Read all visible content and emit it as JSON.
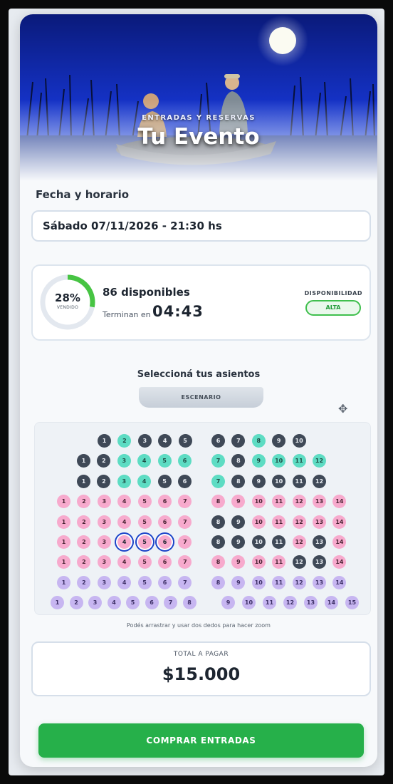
{
  "hero": {
    "eyebrow": "ENTRADAS Y RESERVAS",
    "title": "Tu Evento"
  },
  "schedule": {
    "label": "Fecha y horario",
    "selected": "Sábado 07/11/2026 - 21:30 hs"
  },
  "status": {
    "sold_fraction": 0.28,
    "sold_percent": "28%",
    "sold_caption": "VENDIDO",
    "available": "86 disponibles",
    "ends_label": "Terminan en",
    "timer": "04:43",
    "availability_label": "DISPONIBILIDAD",
    "availability_value": "ALTA",
    "colors": {
      "ring": "#47c443",
      "ring_track": "#e3e8ef",
      "badge": "#3fbf4d"
    }
  },
  "seats": {
    "title": "Seleccioná tus asientos",
    "stage": "ESCENARIO",
    "compass_icon": "move-icon",
    "hint": "Podés arrastrar y usar dos dedos para hacer zoom",
    "rows": [
      {
        "left": [
          [
            "1",
            "dark"
          ],
          [
            "2",
            "teal"
          ],
          [
            "3",
            "dark"
          ],
          [
            "4",
            "dark"
          ],
          [
            "5",
            "dark"
          ]
        ],
        "right": [
          [
            "6",
            "dark"
          ],
          [
            "7",
            "dark"
          ],
          [
            "8",
            "teal"
          ],
          [
            "9",
            "dark"
          ],
          [
            "10",
            "dark"
          ]
        ]
      },
      {
        "left": [
          [
            "1",
            "dark"
          ],
          [
            "2",
            "dark"
          ],
          [
            "3",
            "teal"
          ],
          [
            "4",
            "teal"
          ],
          [
            "5",
            "teal"
          ],
          [
            "6",
            "teal"
          ]
        ],
        "right": [
          [
            "7",
            "teal"
          ],
          [
            "8",
            "dark"
          ],
          [
            "9",
            "teal"
          ],
          [
            "10",
            "teal"
          ],
          [
            "11",
            "teal"
          ],
          [
            "12",
            "teal"
          ]
        ]
      },
      {
        "left": [
          [
            "1",
            "dark"
          ],
          [
            "2",
            "dark"
          ],
          [
            "3",
            "teal"
          ],
          [
            "4",
            "teal"
          ],
          [
            "5",
            "dark"
          ],
          [
            "6",
            "dark"
          ]
        ],
        "right": [
          [
            "7",
            "teal"
          ],
          [
            "8",
            "dark"
          ],
          [
            "9",
            "dark"
          ],
          [
            "10",
            "dark"
          ],
          [
            "11",
            "dark"
          ],
          [
            "12",
            "dark"
          ]
        ]
      },
      {
        "left": [
          [
            "1",
            "pink"
          ],
          [
            "2",
            "pink"
          ],
          [
            "3",
            "pink"
          ],
          [
            "4",
            "pink"
          ],
          [
            "5",
            "pink"
          ],
          [
            "6",
            "pink"
          ],
          [
            "7",
            "pink"
          ]
        ],
        "right": [
          [
            "8",
            "pink"
          ],
          [
            "9",
            "pink"
          ],
          [
            "10",
            "pink"
          ],
          [
            "11",
            "pink"
          ],
          [
            "12",
            "pink"
          ],
          [
            "13",
            "pink"
          ],
          [
            "14",
            "pink"
          ]
        ]
      },
      {
        "left": [
          [
            "1",
            "pink"
          ],
          [
            "2",
            "pink"
          ],
          [
            "3",
            "pink"
          ],
          [
            "4",
            "pink"
          ],
          [
            "5",
            "pink"
          ],
          [
            "6",
            "pink"
          ],
          [
            "7",
            "pink"
          ]
        ],
        "right": [
          [
            "8",
            "dark"
          ],
          [
            "9",
            "dark"
          ],
          [
            "10",
            "pink"
          ],
          [
            "11",
            "pink"
          ],
          [
            "12",
            "pink"
          ],
          [
            "13",
            "pink"
          ],
          [
            "14",
            "pink"
          ]
        ]
      },
      {
        "left": [
          [
            "1",
            "pink"
          ],
          [
            "2",
            "pink"
          ],
          [
            "3",
            "pink"
          ],
          [
            "4",
            "sel"
          ],
          [
            "5",
            "sel"
          ],
          [
            "6",
            "sel"
          ],
          [
            "7",
            "pink"
          ]
        ],
        "right": [
          [
            "8",
            "dark"
          ],
          [
            "9",
            "dark"
          ],
          [
            "10",
            "dark"
          ],
          [
            "11",
            "dark"
          ],
          [
            "12",
            "pink"
          ],
          [
            "13",
            "dark"
          ],
          [
            "14",
            "pink"
          ]
        ]
      },
      {
        "left": [
          [
            "1",
            "pink"
          ],
          [
            "2",
            "pink"
          ],
          [
            "3",
            "pink"
          ],
          [
            "4",
            "pink"
          ],
          [
            "5",
            "pink"
          ],
          [
            "6",
            "pink"
          ],
          [
            "7",
            "pink"
          ]
        ],
        "right": [
          [
            "8",
            "pink"
          ],
          [
            "9",
            "pink"
          ],
          [
            "10",
            "pink"
          ],
          [
            "11",
            "pink"
          ],
          [
            "12",
            "dark"
          ],
          [
            "13",
            "dark"
          ],
          [
            "14",
            "pink"
          ]
        ]
      },
      {
        "left": [
          [
            "1",
            "lav"
          ],
          [
            "2",
            "lav"
          ],
          [
            "3",
            "lav"
          ],
          [
            "4",
            "lav"
          ],
          [
            "5",
            "lav"
          ],
          [
            "6",
            "lav"
          ],
          [
            "7",
            "lav"
          ]
        ],
        "right": [
          [
            "8",
            "lav"
          ],
          [
            "9",
            "lav"
          ],
          [
            "10",
            "lav"
          ],
          [
            "11",
            "lav"
          ],
          [
            "12",
            "lav"
          ],
          [
            "13",
            "lav"
          ],
          [
            "14",
            "lav"
          ]
        ]
      },
      {
        "left": [
          [
            "1",
            "lav"
          ],
          [
            "2",
            "lav"
          ],
          [
            "3",
            "lav"
          ],
          [
            "4",
            "lav"
          ],
          [
            "5",
            "lav"
          ],
          [
            "6",
            "lav"
          ],
          [
            "7",
            "lav"
          ],
          [
            "8",
            "lav"
          ]
        ],
        "right": [
          [
            "9",
            "lav"
          ],
          [
            "10",
            "lav"
          ],
          [
            "11",
            "lav"
          ],
          [
            "12",
            "lav"
          ],
          [
            "13",
            "lav"
          ],
          [
            "14",
            "lav"
          ],
          [
            "15",
            "lav"
          ]
        ]
      }
    ]
  },
  "total": {
    "label": "TOTAL A PAGAR",
    "amount": "$15.000"
  },
  "cta": {
    "label": "COMPRAR ENTRADAS"
  }
}
